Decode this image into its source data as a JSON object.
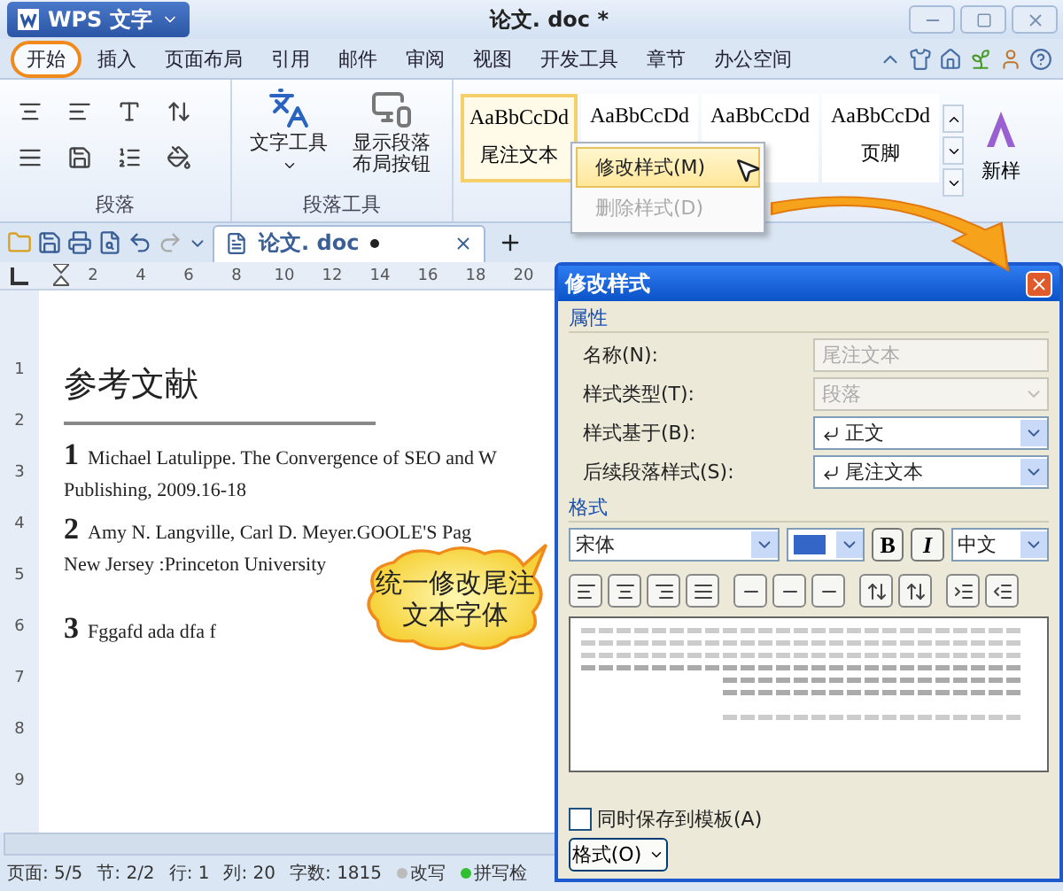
{
  "app_menu": {
    "label": "WPS 文字"
  },
  "window": {
    "title": "论文. doc *"
  },
  "tabs": [
    {
      "label": "开始",
      "selected": true
    },
    {
      "label": "插入",
      "selected": false
    },
    {
      "label": "页面布局",
      "selected": false
    },
    {
      "label": "引用",
      "selected": false
    },
    {
      "label": "邮件",
      "selected": false
    },
    {
      "label": "审阅",
      "selected": false
    },
    {
      "label": "视图",
      "selected": false
    },
    {
      "label": "开发工具",
      "selected": false
    },
    {
      "label": "章节",
      "selected": false
    },
    {
      "label": "办公空间",
      "selected": false
    }
  ],
  "ribbon": {
    "paragraph_group": {
      "label": "段落"
    },
    "tools_group": {
      "label": "段落工具",
      "buttons": [
        {
          "label": "文字工具",
          "kind": "dropdown"
        },
        {
          "label": "显示段落布局按钮",
          "kind": "plain"
        }
      ]
    },
    "styles": [
      {
        "sample": "AaBbCcDd",
        "name": "尾注文本",
        "selected": true
      },
      {
        "sample": "AaBbCcDd",
        "selected": false
      },
      {
        "sample": "AaBbCcDd",
        "selected": false
      },
      {
        "sample": "AaBbCcDd",
        "name": "页脚",
        "selected": false
      }
    ],
    "new_style": {
      "label": "新样"
    }
  },
  "context_menu": [
    {
      "label": "修改样式(M)",
      "selected": true,
      "disabled": false
    },
    {
      "label": "删除样式(D)",
      "selected": false,
      "disabled": true
    }
  ],
  "document_tab": {
    "title": "论文. doc",
    "modified": true
  },
  "ruler": {
    "horizontal": [
      "2",
      "4",
      "6",
      "8",
      "10",
      "12",
      "14",
      "16",
      "18",
      "20"
    ],
    "vertical": [
      "1",
      "2",
      "3",
      "4",
      "5",
      "6",
      "7",
      "8",
      "9"
    ]
  },
  "document": {
    "heading": "参考文献",
    "endnotes": [
      {
        "number": "1",
        "lines": [
          "Michael Latulippe. The Convergence of SEO and W",
          "Publishing, 2009.16-18"
        ]
      },
      {
        "number": "2",
        "lines": [
          "Amy N. Langville, Carl D. Meyer.GOOLE'S Pag",
          "New Jersey :Princeton University"
        ]
      },
      {
        "number": "3",
        "lines": [
          "Fggafd ada dfa f"
        ]
      }
    ]
  },
  "callout": {
    "text": "统一修改尾注文本字体"
  },
  "dialog": {
    "title": "修改样式",
    "properties": {
      "label": "属性",
      "fields": [
        {
          "label": "名称(N):",
          "kind": "text",
          "value": "尾注文本",
          "disabled": true
        },
        {
          "label": "样式类型(T):",
          "kind": "select",
          "value": "段落",
          "disabled": true
        },
        {
          "label": "样式基于(B):",
          "kind": "select",
          "value": "正文",
          "disabled": false
        },
        {
          "label": "后续段落样式(S):",
          "kind": "select",
          "value": "尾注文本",
          "disabled": false
        }
      ]
    },
    "format": {
      "label": "格式",
      "font": "宋体",
      "bold": "B",
      "italic": "I",
      "language": "中文"
    },
    "save_to_template": {
      "label": "同时保存到模板(A)",
      "checked": false
    },
    "format_button": {
      "label": "格式(O)"
    }
  },
  "status_bar": [
    {
      "text": "页面: 5/5",
      "kind": "text"
    },
    {
      "text": "节: 2/2",
      "kind": "text"
    },
    {
      "text": "行: 1",
      "kind": "text"
    },
    {
      "text": "列: 20",
      "kind": "text"
    },
    {
      "text": "字数: 1815",
      "kind": "text"
    },
    {
      "text": "改写",
      "kind": "indicator",
      "on": false
    },
    {
      "text": "拼写检",
      "kind": "indicator",
      "on": true
    }
  ]
}
